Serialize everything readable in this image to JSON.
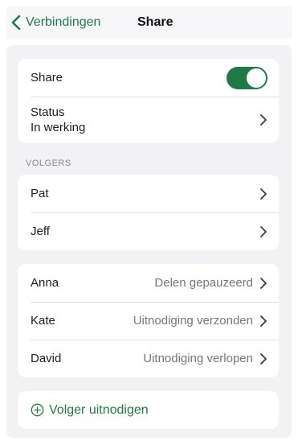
{
  "nav": {
    "back_label": "Verbindingen",
    "title": "Share"
  },
  "share_card": {
    "share_label": "Share",
    "share_enabled": true,
    "status_label": "Status",
    "status_value": "In werking"
  },
  "followers_section": {
    "header": "VOLGERS",
    "items": [
      {
        "name": "Pat"
      },
      {
        "name": "Jeff"
      }
    ]
  },
  "pending_section": {
    "items": [
      {
        "name": "Anna",
        "status": "Delen gepauzeerd"
      },
      {
        "name": "Kate",
        "status": "Uitnodiging verzonden"
      },
      {
        "name": "David",
        "status": "Uitnodiging verlopen"
      }
    ]
  },
  "invite": {
    "label": "Volger uitnodigen"
  },
  "colors": {
    "accent": "#1f7a46",
    "background": "#f2f2f4",
    "card": "#ffffff",
    "secondary_text": "#75757c"
  }
}
